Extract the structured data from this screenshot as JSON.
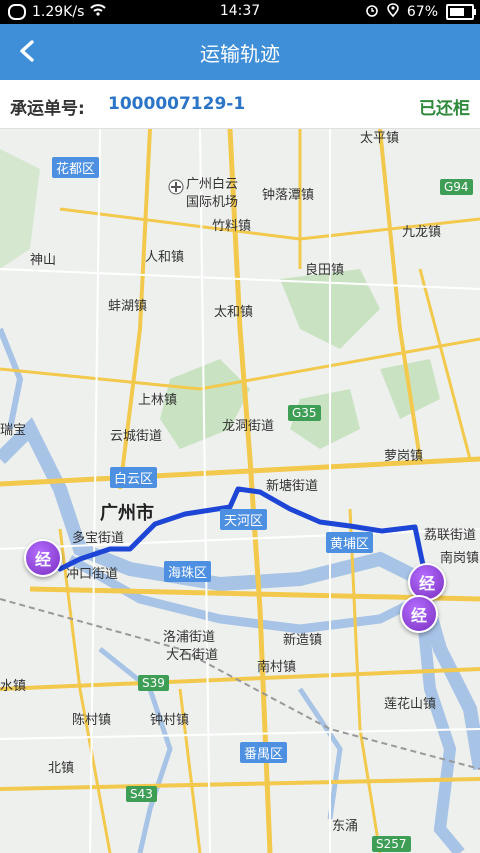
{
  "statusbar": {
    "speed": "1.29K/s",
    "time": "14:37",
    "battery": "67%"
  },
  "nav": {
    "title": "运输轨迹"
  },
  "order": {
    "label": "承运单号:",
    "number": "1000007129-1",
    "status": "已还柜"
  },
  "map": {
    "districts": [
      "花都区",
      "白云区",
      "天河区",
      "黄埔区",
      "海珠区",
      "番禺区"
    ],
    "city": "广州市",
    "places": [
      "广州白云",
      "国际机场",
      "钟落潭镇",
      "太平镇",
      "九龙镇",
      "竹料镇",
      "人和镇",
      "良田镇",
      "神山",
      "蚌湖镇",
      "太和镇",
      "上林镇",
      "云城街道",
      "龙洞街道",
      "新塘街道",
      "萝岗镇",
      "多宝街道",
      "冲口街道",
      "瑞宝",
      "荔联街道",
      "南岗镇",
      "洛浦街道",
      "大石街道",
      "新造镇",
      "南村镇",
      "莲花山镇",
      "陈村镇",
      "钟村镇",
      "北镇",
      "东涌",
      "水镇"
    ],
    "highways": [
      "G94",
      "G35",
      "S39",
      "S43",
      "S257"
    ],
    "waypoint_label": "经",
    "colors": {
      "route": "#1e46d6",
      "accent": "#3f8ed8",
      "status": "#2f8a3b"
    }
  }
}
